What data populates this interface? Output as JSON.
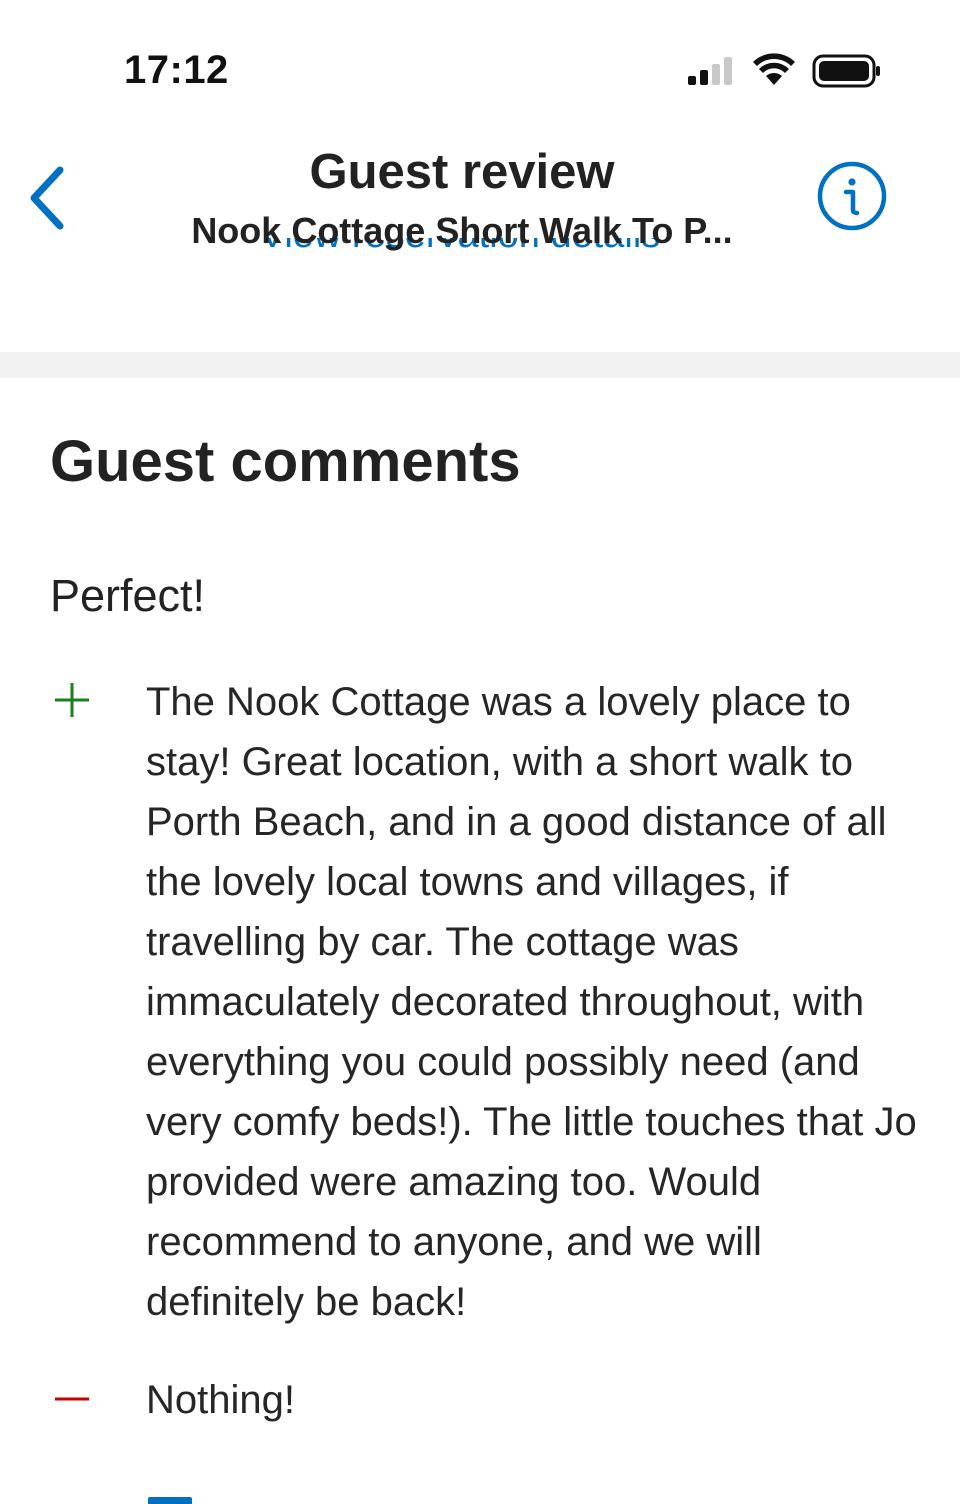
{
  "status_bar": {
    "time": "17:12",
    "icons": [
      "cellular-signal-icon",
      "wifi-icon",
      "battery-icon"
    ]
  },
  "header": {
    "title": "Guest review",
    "subtitle": "Nook Cottage Short Walk To P...",
    "link_label": "View reservation details",
    "back_icon": "chevron-left-icon",
    "info_icon": "info-icon"
  },
  "colors": {
    "accent": "#0071c2",
    "positive": "#1e7e1e",
    "negative": "#cc0000",
    "divider": "#f2f2f2"
  },
  "comments": {
    "section_title": "Guest comments",
    "headline": "Perfect!",
    "positive": "The Nook Cottage was a lovely place to stay! Great location, with a short walk to Porth Beach, and in a good distance of all the lovely local towns and villages, if travelling by car. The cottage was immaculately decorated throughout, with everything you could possibly need (and very comfy beds!). The little touches that Jo provided were amazing too. Would recommend to anyone, and we will definitely be back!",
    "negative": "Nothing!"
  }
}
